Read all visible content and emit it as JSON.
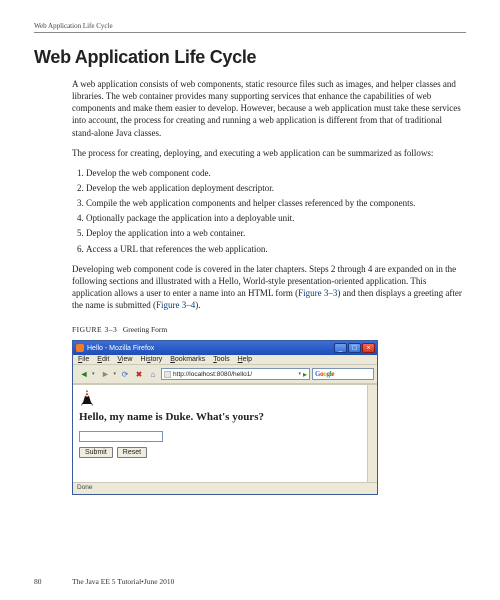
{
  "running_head": "Web Application Life Cycle",
  "title": "Web Application Life Cycle",
  "intro_para": "A web application consists of web components, static resource files such as images, and helper classes and libraries. The web container provides many supporting services that enhance the capabilities of web components and make them easier to develop. However, because a web application must take these services into account, the process for creating and running a web application is different from that of traditional stand-alone Java classes.",
  "process_para": "The process for creating, deploying, and executing a web application can be summarized as follows:",
  "steps": [
    "Develop the web component code.",
    "Develop the web application deployment descriptor.",
    "Compile the web application components and helper classes referenced by the components.",
    "Optionally package the application into a deployable unit.",
    "Deploy the application into a web container.",
    "Access a URL that references the web application."
  ],
  "closing_para_pre": "Developing web component code is covered in the later chapters. Steps 2 through 4 are expanded on in the following sections and illustrated with a Hello, World-style presentation-oriented application. This application allows a user to enter a name into an HTML form (",
  "link1": "Figure 3–3",
  "closing_para_mid": ") and then displays a greeting after the name is submitted (",
  "link2": "Figure 3–4",
  "closing_para_end": ").",
  "figure_label_caps": "FIGURE 3–3",
  "figure_caption": "Greeting Form",
  "browser": {
    "title": "Hello - Mozilla Firefox",
    "menu": {
      "file": "File",
      "edit": "Edit",
      "view": "View",
      "history": "History",
      "bookmarks": "Bookmarks",
      "tools": "Tools",
      "help": "Help"
    },
    "url": "http://localhost:8080/hello1/",
    "search_placeholder": "Google",
    "greeting": "Hello, my name is Duke. What's yours?",
    "submit": "Submit",
    "reset": "Reset",
    "status": "Done"
  },
  "footer": {
    "page": "80",
    "book": "The Java EE 5 Tutorial",
    "sep": " • ",
    "date": "June 2010"
  }
}
